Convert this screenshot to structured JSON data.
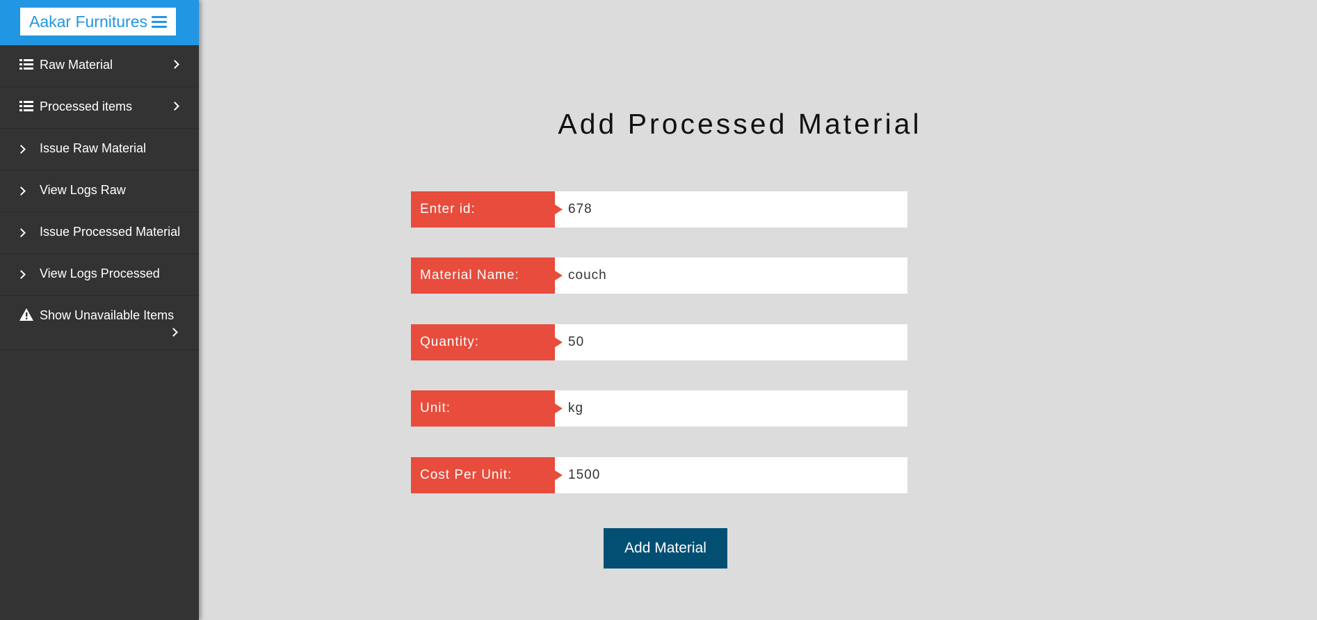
{
  "brand": {
    "name": "Aakar Furnitures",
    "menu_icon": "hamburger-icon",
    "color": "#2196e3"
  },
  "sidebar": {
    "items": [
      {
        "label": "Raw Material",
        "icon": "list-icon",
        "has_chevron": true
      },
      {
        "label": "Processed items",
        "icon": "list-icon",
        "has_chevron": true
      },
      {
        "label": "Issue Raw Material",
        "icon": "chevron-right-icon"
      },
      {
        "label": "View Logs Raw",
        "icon": "chevron-right-icon"
      },
      {
        "label": "Issue Processed Material",
        "icon": "chevron-right-icon"
      },
      {
        "label": "View Logs Processed",
        "icon": "chevron-right-icon"
      },
      {
        "label": "Show Unavailable Items",
        "icon": "warning-icon",
        "has_chevron": true
      }
    ]
  },
  "main": {
    "title": "Add Processed Material",
    "fields": [
      {
        "label": "Enter id:",
        "value": "678"
      },
      {
        "label": "Material Name:",
        "value": "couch"
      },
      {
        "label": "Quantity:",
        "value": "50"
      },
      {
        "label": "Unit:",
        "value": "kg"
      },
      {
        "label": "Cost Per Unit:",
        "value": "1500"
      }
    ],
    "submit_label": "Add Material"
  },
  "colors": {
    "sidebar_bg": "#333333",
    "page_bg": "#dcdcdc",
    "label_bg": "#e74c3c",
    "button_bg": "#034f74"
  }
}
